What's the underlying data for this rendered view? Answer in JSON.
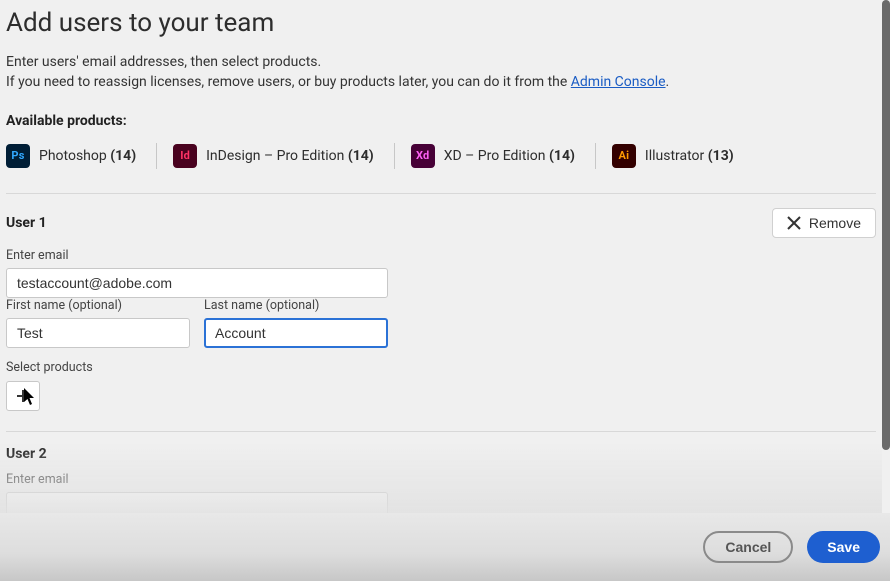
{
  "header": {
    "title": "Add users to your team",
    "intro1": "Enter users' email addresses, then select products.",
    "intro2_prefix": "If you need to reassign licenses, remove users, or buy products later, you can do it from the ",
    "intro2_link": "Admin Console",
    "intro2_suffix": "."
  },
  "products": {
    "label": "Available products:",
    "items": [
      {
        "icon": "Ps",
        "css": "ps",
        "name": "Photoshop",
        "count": "(14)"
      },
      {
        "icon": "Id",
        "css": "id",
        "name": "InDesign – Pro Edition",
        "count": "(14)"
      },
      {
        "icon": "Xd",
        "css": "xd",
        "name": "XD – Pro Edition",
        "count": "(14)"
      },
      {
        "icon": "Ai",
        "css": "ai",
        "name": "Illustrator",
        "count": "(13)"
      }
    ]
  },
  "users": [
    {
      "title": "User 1",
      "remove_label": "Remove",
      "email_label": "Enter email",
      "email_value": "testaccount@adobe.com",
      "first_label": "First name (optional)",
      "first_value": "Test",
      "last_label": "Last name (optional)",
      "last_value": "Account",
      "select_products_label": "Select products"
    },
    {
      "title": "User 2",
      "email_label": "Enter email",
      "email_value": ""
    }
  ],
  "footer": {
    "cancel": "Cancel",
    "save": "Save"
  }
}
